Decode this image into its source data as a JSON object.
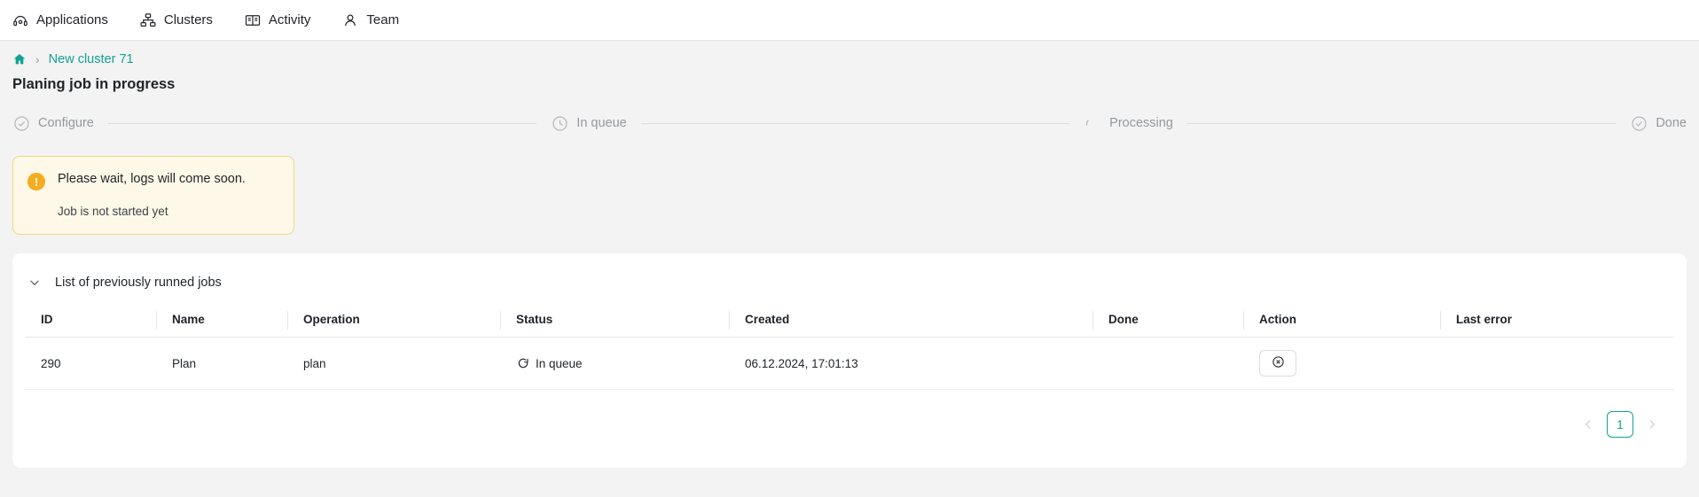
{
  "nav": {
    "items": [
      {
        "label": "Applications",
        "icon": "applications-icon"
      },
      {
        "label": "Clusters",
        "icon": "clusters-icon"
      },
      {
        "label": "Activity",
        "icon": "activity-icon"
      },
      {
        "label": "Team",
        "icon": "team-icon"
      }
    ]
  },
  "breadcrumb": {
    "home_icon": "home-icon",
    "separator": "›",
    "link": "New cluster 71"
  },
  "page": {
    "title": "Planing job in progress"
  },
  "stepper": {
    "steps": [
      {
        "label": "Configure",
        "icon": "check-circle-icon",
        "state": "done"
      },
      {
        "label": "In queue",
        "icon": "clock-icon",
        "state": "current"
      },
      {
        "label": "Processing",
        "icon": "spinner-arc-icon",
        "state": "pending"
      },
      {
        "label": "Done",
        "icon": "check-circle-icon",
        "state": "pending"
      }
    ]
  },
  "alert": {
    "icon": "exclamation-circle-icon",
    "icon_glyph": "!",
    "title": "Please wait, logs will come soon.",
    "subtitle": "Job is not started yet",
    "bg_color": "#fdf8e7",
    "border_color": "#f5d780",
    "icon_color": "#f4ad1e"
  },
  "jobs_panel": {
    "chevron_icon": "chevron-down-icon",
    "title": "List of previously runned jobs",
    "columns": [
      "ID",
      "Name",
      "Operation",
      "Status",
      "Created",
      "Done",
      "Action",
      "Last error"
    ],
    "rows": [
      {
        "id": "290",
        "name": "Plan",
        "operation": "plan",
        "status": "In queue",
        "status_icon": "refresh-spinner-icon",
        "created": "06.12.2024, 17:01:13",
        "done": "",
        "action_icon": "cancel-circle-icon",
        "last_error": ""
      }
    ]
  },
  "pagination": {
    "prev_icon": "chevron-left-icon",
    "next_icon": "chevron-right-icon",
    "current_page": "1",
    "accent_color": "#11a391"
  }
}
